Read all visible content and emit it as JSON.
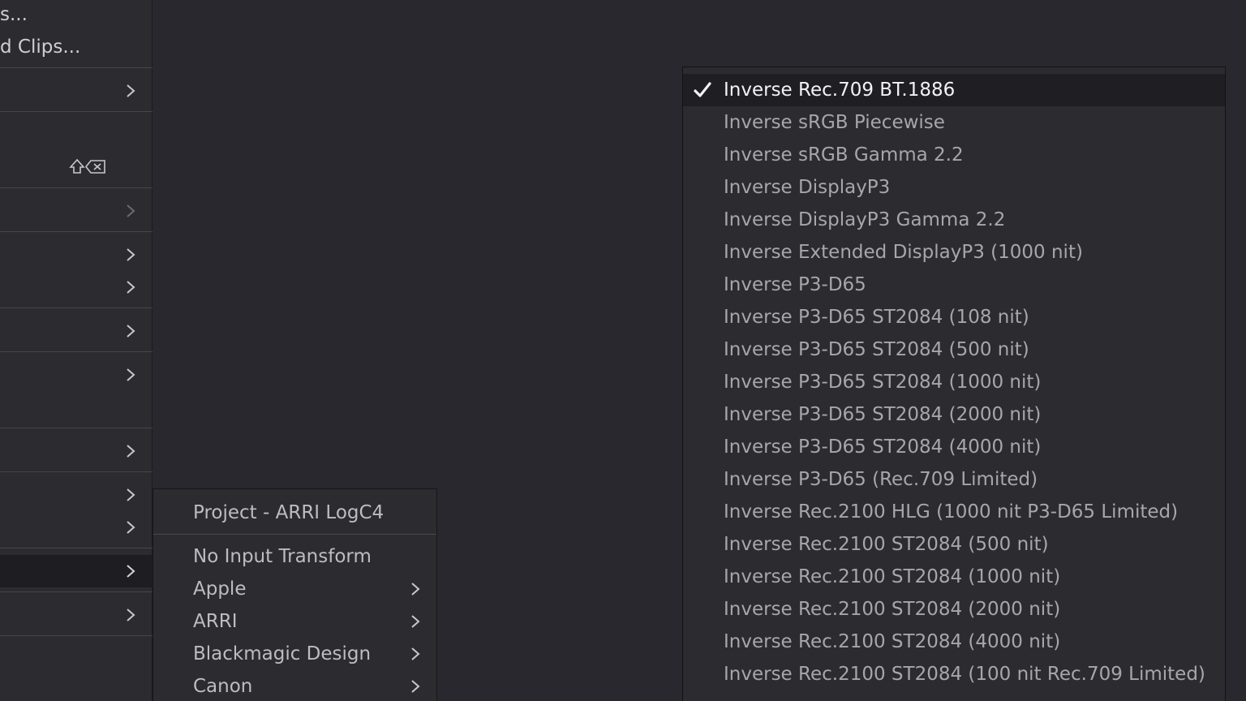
{
  "left_menu": {
    "item_1_label": "s...",
    "item_2_label": "d Clips...",
    "shortcut_icon": "shift-delete-icon"
  },
  "input_transform_menu": {
    "current": "Project - ARRI LogC4",
    "items": [
      {
        "label": "No Input Transform",
        "has_submenu": false
      },
      {
        "label": "Apple",
        "has_submenu": true
      },
      {
        "label": "ARRI",
        "has_submenu": true
      },
      {
        "label": "Blackmagic Design",
        "has_submenu": true
      },
      {
        "label": "Canon",
        "has_submenu": true
      }
    ]
  },
  "output_transform_menu": {
    "selected": "Inverse Rec.709 BT.1886",
    "items": [
      "Inverse Rec.709 BT.1886",
      "Inverse sRGB Piecewise",
      "Inverse sRGB Gamma 2.2",
      "Inverse DisplayP3",
      "Inverse DisplayP3 Gamma 2.2",
      "Inverse Extended DisplayP3 (1000 nit)",
      "Inverse P3-D65",
      "Inverse P3-D65 ST2084 (108 nit)",
      "Inverse P3-D65 ST2084 (500 nit)",
      "Inverse P3-D65 ST2084 (1000 nit)",
      "Inverse P3-D65 ST2084 (2000 nit)",
      "Inverse P3-D65 ST2084 (4000 nit)",
      "Inverse P3-D65 (Rec.709 Limited)",
      "Inverse Rec.2100 HLG (1000 nit P3-D65 Limited)",
      "Inverse Rec.2100 ST2084 (500 nit)",
      "Inverse Rec.2100 ST2084 (1000 nit)",
      "Inverse Rec.2100 ST2084 (2000 nit)",
      "Inverse Rec.2100 ST2084 (4000 nit)",
      "Inverse Rec.2100 ST2084 (100 nit Rec.709 Limited)"
    ]
  },
  "colors": {
    "background": "#28282e",
    "menu_background": "#2b2b30",
    "highlight": "#1f1f23",
    "text_active": "#f2f2f4",
    "text_normal": "#a7a7ab"
  }
}
